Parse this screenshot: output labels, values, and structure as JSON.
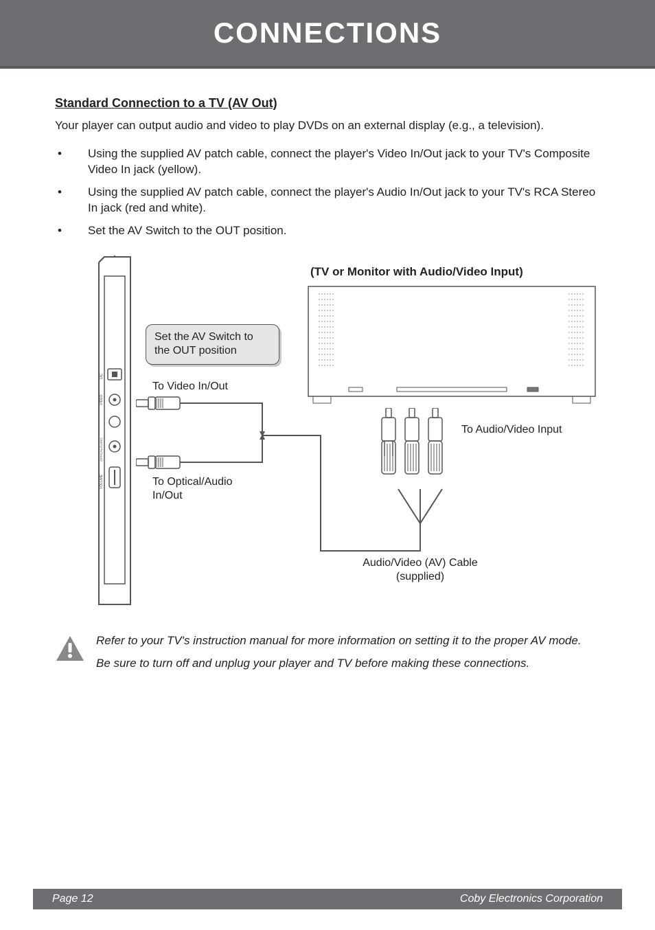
{
  "header": {
    "title": "CONNECTIONS"
  },
  "section": {
    "title": "Standard Connection to a TV (AV Out)",
    "intro": "Your player can output audio and video to play DVDs on an external display (e.g., a television).",
    "bullets": [
      "Using the supplied AV patch cable, connect the player's Video In/Out jack to your TV's Composite Video In jack (yellow).",
      "Using the supplied AV patch cable, connect the player's Audio In/Out jack to your TV's RCA Stereo In jack (red and white).",
      "Set the AV Switch to the OUT position."
    ]
  },
  "diagram": {
    "tv_title": "(TV or Monitor with Audio/Video Input)",
    "callout": "Set the AV Switch to the OUT position",
    "label_video": "To Video In/Out",
    "label_optical": "To Optical/Audio In/Out",
    "label_rca": "To Audio/Video Input",
    "cable_caption_line1": "Audio/Video (AV) Cable",
    "cable_caption_line2": "(supplied)",
    "side_ports": {
      "dc": "DC",
      "video": "VIDEO",
      "optical": "OPTICAL/AUDIO",
      "volume": "VOLUME"
    }
  },
  "notes": [
    "Refer to your TV's instruction manual for more information on setting it to the proper AV mode.",
    "Be sure to turn off and unplug your player and TV before making these connections."
  ],
  "footer": {
    "page": "Page 12",
    "company": "Coby Electronics Corporation"
  }
}
